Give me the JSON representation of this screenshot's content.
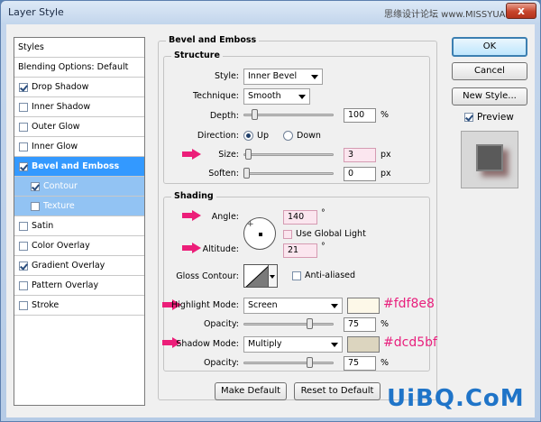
{
  "window": {
    "title": "Layer Style",
    "watermark_top": "思缘设计论坛 www.MISSYUAN.COM",
    "close_label": "x"
  },
  "styles_list": {
    "header": "Styles",
    "blending": "Blending Options: Default",
    "items": [
      {
        "label": "Drop Shadow",
        "checked": true
      },
      {
        "label": "Inner Shadow",
        "checked": false
      },
      {
        "label": "Outer Glow",
        "checked": false
      },
      {
        "label": "Inner Glow",
        "checked": false
      },
      {
        "label": "Bevel and Emboss",
        "checked": true,
        "selected": true
      },
      {
        "label": "Contour",
        "checked": true,
        "sub": true
      },
      {
        "label": "Texture",
        "checked": false,
        "sub": true
      },
      {
        "label": "Satin",
        "checked": false
      },
      {
        "label": "Color Overlay",
        "checked": false
      },
      {
        "label": "Gradient Overlay",
        "checked": true
      },
      {
        "label": "Pattern Overlay",
        "checked": false
      },
      {
        "label": "Stroke",
        "checked": false
      }
    ]
  },
  "bevel": {
    "panel_title": "Bevel and Emboss",
    "structure": {
      "title": "Structure",
      "style_label": "Style:",
      "style_value": "Inner Bevel",
      "technique_label": "Technique:",
      "technique_value": "Smooth",
      "depth_label": "Depth:",
      "depth_value": "100",
      "depth_unit": "%",
      "depth_slider": 0.1,
      "direction_label": "Direction:",
      "up_label": "Up",
      "down_label": "Down",
      "direction": "Up",
      "size_label": "Size:",
      "size_value": "3",
      "size_unit": "px",
      "size_slider": 0.02,
      "soften_label": "Soften:",
      "soften_value": "0",
      "soften_unit": "px",
      "soften_slider": 0
    },
    "shading": {
      "title": "Shading",
      "angle_label": "Angle:",
      "angle_value": "140",
      "angle_unit": "°",
      "use_global_light_label": "Use Global Light",
      "use_global_light": false,
      "altitude_label": "Altitude:",
      "altitude_value": "21",
      "altitude_unit": "°",
      "gloss_contour_label": "Gloss Contour:",
      "anti_aliased_label": "Anti-aliased",
      "anti_aliased": false,
      "highlight_mode_label": "Highlight Mode:",
      "highlight_mode_value": "Screen",
      "highlight_color": "#fdf8e8",
      "highlight_hex_label": "#fdf8e8",
      "highlight_opacity_label": "Opacity:",
      "highlight_opacity_value": "75",
      "highlight_opacity_unit": "%",
      "highlight_opacity_slider": 0.75,
      "shadow_mode_label": "Shadow Mode:",
      "shadow_mode_value": "Multiply",
      "shadow_color": "#dcd5bf",
      "shadow_hex_label": "#dcd5bf",
      "shadow_opacity_label": "Opacity:",
      "shadow_opacity_value": "75",
      "shadow_opacity_unit": "%",
      "shadow_opacity_slider": 0.75
    },
    "make_default_label": "Make Default",
    "reset_default_label": "Reset to Default"
  },
  "right_panel": {
    "ok_label": "OK",
    "cancel_label": "Cancel",
    "new_style_label": "New Style...",
    "preview_label": "Preview",
    "preview_checked": true
  },
  "watermark_bottom": "UiBQ.CoM",
  "colors": {
    "accent_pink": "#ec1e79",
    "selected_blue": "#3399ff"
  }
}
